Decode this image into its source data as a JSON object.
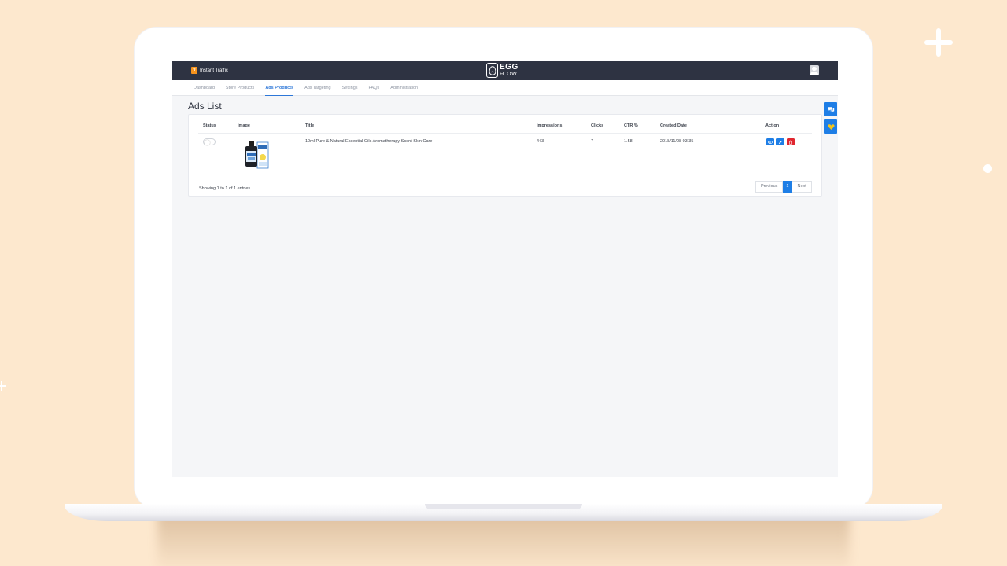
{
  "app": {
    "brand_name": "Instant Traffic",
    "brand_icon": "lightning-badge-icon",
    "logo_line1": "EGG",
    "logo_line2": "FLOW"
  },
  "nav": {
    "tabs": [
      {
        "label": "Dashboard",
        "active": false
      },
      {
        "label": "Store Products",
        "active": false
      },
      {
        "label": "Ads Products",
        "active": true
      },
      {
        "label": "Ads Targeting",
        "active": false
      },
      {
        "label": "Settings",
        "active": false
      },
      {
        "label": "FAQs",
        "active": false
      },
      {
        "label": "Administration",
        "active": false
      }
    ]
  },
  "page": {
    "title": "Ads List"
  },
  "table": {
    "columns": [
      "Status",
      "Image",
      "Title",
      "Impressions",
      "Clicks",
      "CTR %",
      "Created Date",
      "Action"
    ],
    "rows": [
      {
        "status_on": false,
        "image": "essential-oil-bottle-image",
        "title": "10ml Pure & Natural Essential Oils Aromatherapy Scent Skin Care",
        "impressions": "443",
        "clicks": "7",
        "ctr": "1.58",
        "created_date": "2018/11/08 03:35",
        "actions": [
          "view-icon",
          "edit-icon",
          "delete-icon"
        ]
      }
    ],
    "showing_text": "Showing 1 to 1 of 1 entries"
  },
  "pagination": {
    "previous": "Previous",
    "current": "1",
    "next": "Next"
  },
  "side_widgets": [
    "chat-icon",
    "heart-icon"
  ],
  "colors": {
    "background": "#fde8ce",
    "topbar": "#2e3342",
    "accent": "#1e7ee6",
    "danger": "#e0262f",
    "brand_orange": "#f7941d"
  }
}
